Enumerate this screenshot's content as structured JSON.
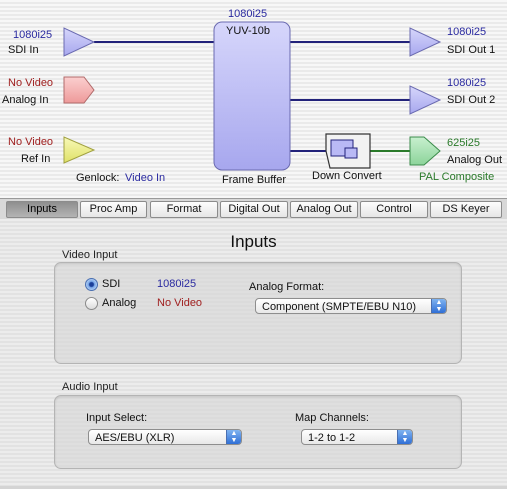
{
  "diagram": {
    "sdi_in": {
      "format": "1080i25",
      "label": "SDI In"
    },
    "analog_in": {
      "status": "No Video",
      "label": "Analog In"
    },
    "ref_in": {
      "status": "No Video",
      "label": "Ref In"
    },
    "genlock": {
      "label": "Genlock:",
      "value": "Video In"
    },
    "frame_buffer": {
      "format": "1080i25",
      "sub": "YUV-10b",
      "label": "Frame Buffer"
    },
    "down_convert": {
      "label": "Down Convert"
    },
    "sdi_out_1": {
      "format": "1080i25",
      "label": "SDI Out 1"
    },
    "sdi_out_2": {
      "format": "1080i25",
      "label": "SDI Out 2"
    },
    "analog_out": {
      "format": "625i25",
      "label": "Analog Out",
      "sub": "PAL Composite"
    },
    "colors": {
      "blue_fill": "#b9b9f5",
      "pink_fill": "#f5aeae",
      "yellow_fill": "#eef08a",
      "green_fill": "#a6e0b0",
      "blue_line": "#22227a",
      "green_line": "#2a7a2a"
    }
  },
  "tabs": [
    {
      "label": "Inputs",
      "active": true
    },
    {
      "label": "Proc Amp"
    },
    {
      "label": "Format"
    },
    {
      "label": "Digital Out"
    },
    {
      "label": "Analog Out"
    },
    {
      "label": "Control"
    },
    {
      "label": "DS Keyer"
    }
  ],
  "page": {
    "title": "Inputs"
  },
  "video_input": {
    "section_label": "Video Input",
    "sdi": {
      "label": "SDI",
      "value": "1080i25",
      "selected": true
    },
    "analog": {
      "label": "Analog",
      "value": "No Video",
      "selected": false
    },
    "analog_format": {
      "label": "Analog Format:",
      "selected": "Component (SMPTE/EBU N10)"
    }
  },
  "audio_input": {
    "section_label": "Audio Input",
    "input_select": {
      "label": "Input Select:",
      "selected": "AES/EBU  (XLR)"
    },
    "map_channels": {
      "label": "Map Channels:",
      "selected": "1-2 to 1-2"
    }
  }
}
